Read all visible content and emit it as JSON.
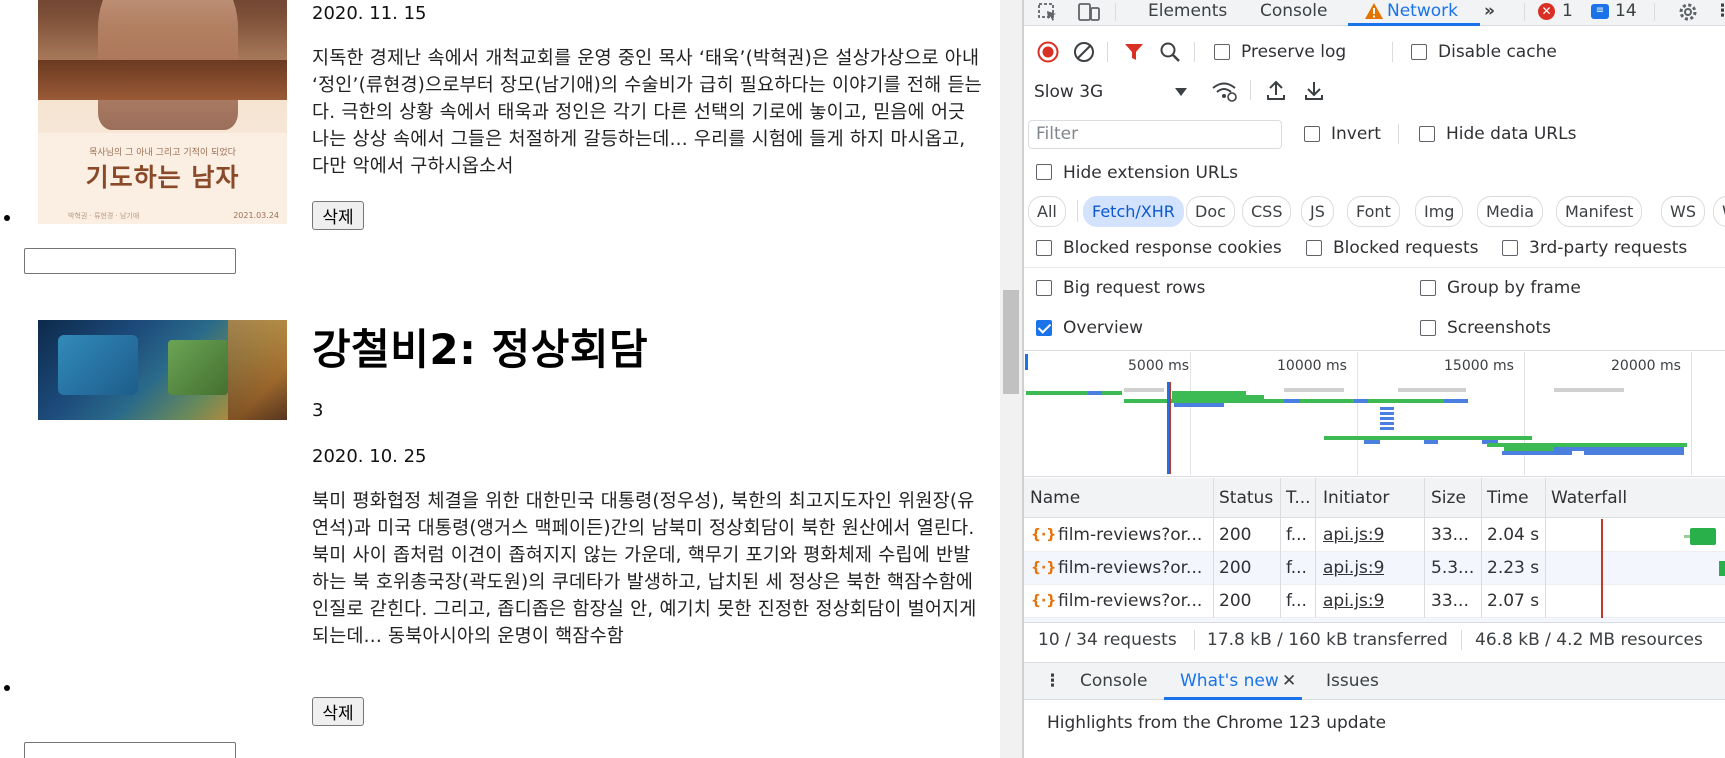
{
  "left": {
    "item1": {
      "poster_tagline": "목사님의 그 아내 그리고 기적이 되었다",
      "poster_title": "기도하는 남자",
      "poster_date": "2021.03.24",
      "poster_credits": "박혁권 · 류현경 · 남기애",
      "date": "2020. 11. 15",
      "description": "지독한 경제난 속에서 개척교회를 운영 중인 목사 ‘태욱’(박혁권)은 설상가상으로 아내 ‘정인’(류현경)으로부터 장모(남기애)의 수술비가 급히 필요하다는 이야기를 전해 듣는다. 극한의 상황 속에서 태욱과 정인은 각기 다른 선택의 기로에 놓이고, 믿음에 어긋나는 상상 속에서 그들은 처절하게 갈등하는데... 우리를 시험에 들게 하지 마시옵고, 다만 악에서 구하시옵소서",
      "delete_label": "삭제"
    },
    "item2": {
      "title": "강철비2: 정상회담",
      "score": "3",
      "date": "2020. 10. 25",
      "description": "북미 평화협정 체결을 위한 대한민국 대통령(정우성), 북한의 최고지도자인 위원장(유연석)과 미국 대통령(앵거스 맥페이든)간의 남북미 정상회담이 북한 원산에서 열린다. 북미 사이 좁처럼 이견이 좁혀지지 않는 가운데, 핵무기 포기와 평화체제 수립에 반발하는 북 호위총국장(곽도원)의 쿠데타가 발생하고, 납치된 세 정상은 북한 핵잠수함에 인질로 갇힌다. 그리고, 좁디좁은 함장실 안, 예기치 못한 진정한 정상회담이 벌어지게 되는데... 동북아시아의 운명이 핵잠수함",
      "delete_label": "삭제"
    }
  },
  "devtools": {
    "tabs": [
      "Elements",
      "Console",
      "Network"
    ],
    "active_tab": "Network",
    "error_count": "1",
    "message_count": "14",
    "throttle": "Slow 3G",
    "preserve_log": "Preserve log",
    "disable_cache": "Disable cache",
    "filter_placeholder": "Filter",
    "invert": "Invert",
    "hide_data_urls": "Hide data URLs",
    "hide_extension_urls": "Hide extension URLs",
    "chips": [
      "All",
      "Fetch/XHR",
      "Doc",
      "CSS",
      "JS",
      "Font",
      "Img",
      "Media",
      "Manifest",
      "WS",
      "Wasm"
    ],
    "active_chip": "Fetch/XHR",
    "blocked_response_cookies": "Blocked response cookies",
    "blocked_requests": "Blocked requests",
    "third_party": "3rd-party requests",
    "big_request_rows": "Big request rows",
    "group_by_frame": "Group by frame",
    "overview": "Overview",
    "screenshots": "Screenshots",
    "timeline_ticks": [
      "5000 ms",
      "10000 ms",
      "15000 ms",
      "20000 ms"
    ],
    "columns": [
      "Name",
      "Status",
      "T...",
      "Initiator",
      "Size",
      "Time",
      "Waterfall"
    ],
    "rows": [
      {
        "name": "film-reviews?or...",
        "status": "200",
        "type": "f...",
        "initiator": "api.js:9",
        "size": "33...",
        "time": "2.04 s"
      },
      {
        "name": "film-reviews?or...",
        "status": "200",
        "type": "f...",
        "initiator": "api.js:9",
        "size": "5.3...",
        "time": "2.23 s"
      },
      {
        "name": "film-reviews?or...",
        "status": "200",
        "type": "f...",
        "initiator": "api.js:9",
        "size": "33...",
        "time": "2.07 s"
      }
    ],
    "summary": {
      "requests": "10 / 34 requests",
      "transferred": "17.8 kB / 160 kB transferred",
      "resources": "46.8 kB / 4.2 MB resources"
    },
    "drawer_tabs": [
      "Console",
      "What's new",
      "Issues"
    ],
    "active_drawer_tab": "What's new",
    "highlights": "Highlights from the Chrome 123 update"
  }
}
